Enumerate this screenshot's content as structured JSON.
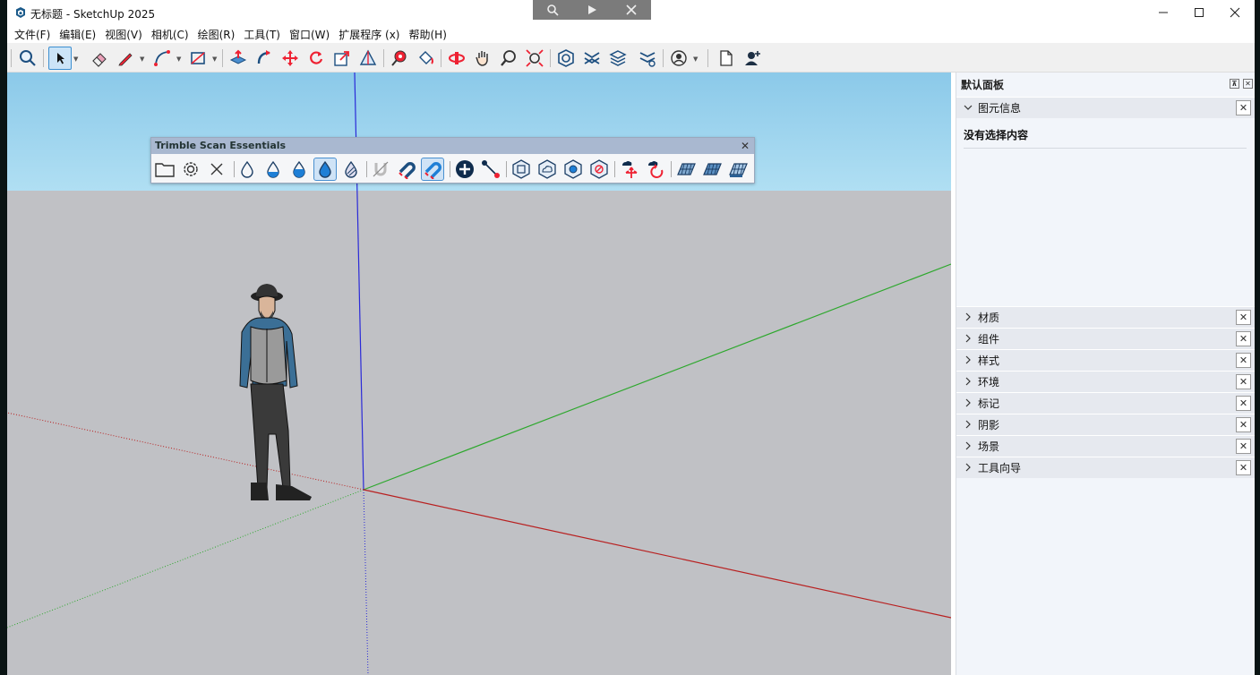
{
  "window": {
    "title": "无标题 - SketchUp 2025",
    "minimize": "—",
    "maximize": "☐",
    "close": "✕"
  },
  "remote_bar": {
    "icons": [
      "search-icon",
      "play-icon",
      "close-icon"
    ]
  },
  "menu": [
    "文件(F)",
    "编辑(E)",
    "视图(V)",
    "相机(C)",
    "绘图(R)",
    "工具(T)",
    "窗口(W)",
    "扩展程序 (x)",
    "帮助(H)"
  ],
  "toolbar": {
    "tools": [
      "search",
      "select",
      "eraser",
      "pencil",
      "arc",
      "rectangle",
      "push-pull",
      "follow-me",
      "move",
      "rotate",
      "scale",
      "offset",
      "tape-measure",
      "paint-bucket",
      "orbit",
      "pan",
      "zoom",
      "zoom-extents",
      "warehouse",
      "extension-warehouse",
      "layers",
      "style-builder",
      "account",
      "new-file",
      "add-user"
    ]
  },
  "scan_toolbar": {
    "title": "Trimble Scan Essentials",
    "close": "✕"
  },
  "panel": {
    "title": "默认面板",
    "entity_info": {
      "label": "图元信息",
      "empty_text": "没有选择内容"
    },
    "sections": [
      "材质",
      "组件",
      "样式",
      "环境",
      "标记",
      "阴影",
      "场景",
      "工具向导"
    ],
    "close_glyph": "✕"
  },
  "colors": {
    "sky": "#8bc9e9",
    "ground": "#c0c1c5",
    "axis_blue": "#2a2ad8",
    "axis_green": "#2ea82e",
    "axis_red": "#b82020",
    "panel_bg": "#f2f5fa"
  }
}
